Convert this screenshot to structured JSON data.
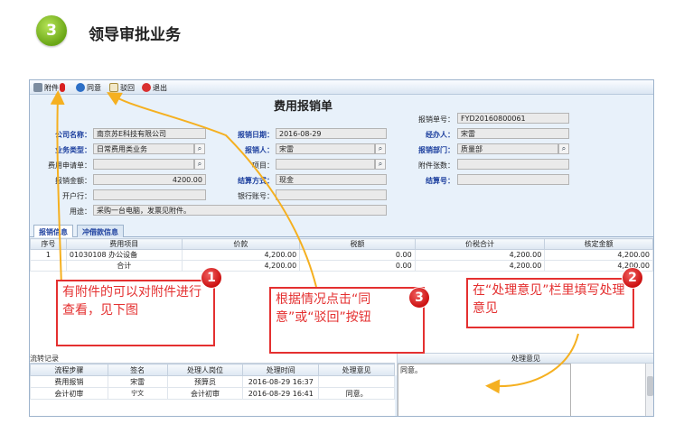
{
  "heading": {
    "step_number": "3",
    "title": "领导审批业务"
  },
  "toolbar": {
    "attach_label": "附件",
    "approve_label": "同意",
    "reject_label": "驳回",
    "exit_label": "退出"
  },
  "form": {
    "title": "费用报销单",
    "fields": {
      "doc_no_label": "报销单号：",
      "doc_no_value": "FYD20160800061",
      "company_label": "公司名称：",
      "company_value": "南京苏E科技有限公司",
      "date_label": "报销日期：",
      "date_value": "2016-08-29",
      "handler_label": "经办人：",
      "handler_value": "宋雷",
      "biz_type_label": "业务类型：",
      "biz_type_value": "日常费用类业务",
      "applicant_label": "报销人：",
      "applicant_value": "宋雷",
      "dept_label": "报销部门：",
      "dept_value": "质量部",
      "request_label": "费用申请单：",
      "request_value": "",
      "project_label": "项目：",
      "project_value": "",
      "attach_count_label": "附件张数：",
      "attach_count_value": "",
      "amount_label": "报销金额：",
      "amount_value": "4200.00",
      "settle_label": "结算方式：",
      "settle_value": "现金",
      "settle_no_label": "结算号：",
      "settle_no_value": "",
      "bank_label": "开户行：",
      "bank_value": "",
      "account_label": "银行账号：",
      "account_value": "",
      "purpose_label": "用途：",
      "purpose_value": "采购一台电脑，发票见附件。"
    }
  },
  "tabs": [
    {
      "label": "报销信息"
    },
    {
      "label": "冲借款信息"
    }
  ],
  "detail_table": {
    "headers": [
      "序号",
      "费用项目",
      "价款",
      "税额",
      "价税合计",
      "核定金额"
    ],
    "rows": [
      [
        "1",
        "01030108 办公设备",
        "4,200.00",
        "0.00",
        "4,200.00",
        "4,200.00"
      ],
      [
        "",
        "合计",
        "4,200.00",
        "0.00",
        "4,200.00",
        "4,200.00"
      ]
    ]
  },
  "flow": {
    "title": "流转记录",
    "headers": [
      "流程步骤",
      "签名",
      "处理人岗位",
      "处理时间",
      "处理意见"
    ],
    "rows": [
      [
        "费用报销",
        "宋雷",
        "预算员",
        "2016-08-29 16:37",
        ""
      ],
      [
        "会计初审",
        "",
        "会计初审",
        "2016-08-29 16:41",
        "同意。"
      ]
    ],
    "signature_text": "宁文"
  },
  "opinion": {
    "header": "处理意见",
    "value": "同意。"
  },
  "callouts": [
    {
      "number": "1",
      "text": "有附件的可以对附件进行查看，见下图"
    },
    {
      "number": "3",
      "text": "根据情况点击“同意”或“驳回”按钮"
    },
    {
      "number": "2",
      "text": "在“处理意见”栏里填写处理意见"
    }
  ],
  "colors": {
    "accent_red": "#e43030",
    "arrow": "#f5b020",
    "badge_green": "#7cba1e",
    "label_blue": "#1c3f9e"
  }
}
